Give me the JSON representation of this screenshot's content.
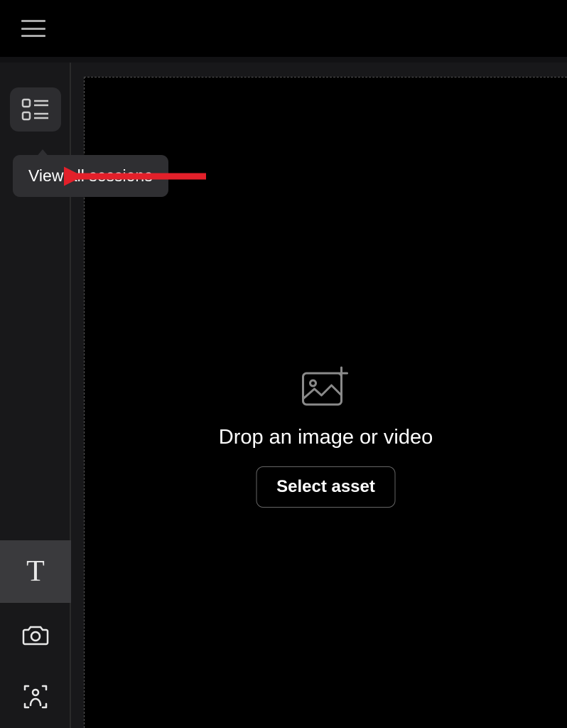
{
  "tooltip": {
    "label": "View all sessions"
  },
  "dropzone": {
    "text": "Drop an image or video",
    "button_label": "Select asset"
  },
  "tools": {
    "text_label": "T"
  }
}
